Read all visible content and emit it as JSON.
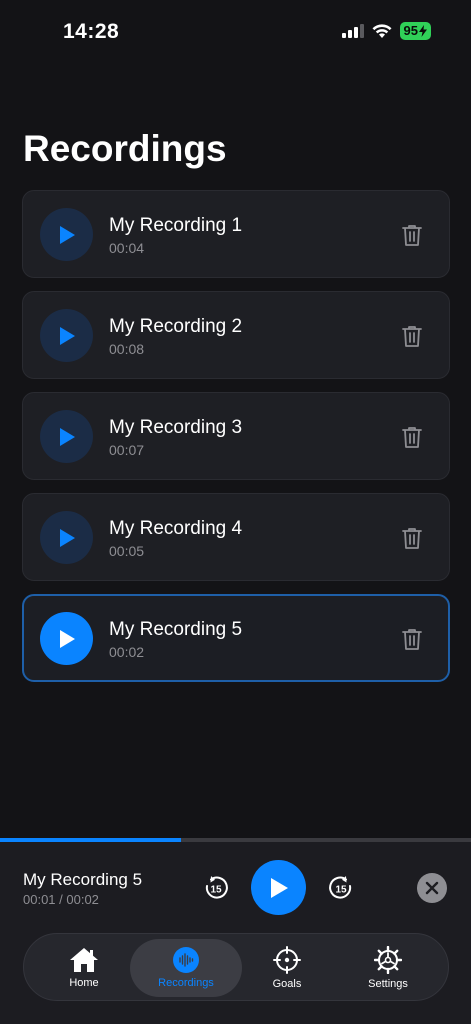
{
  "status": {
    "time": "14:28",
    "battery": "95"
  },
  "page": {
    "title": "Recordings"
  },
  "recordings": [
    {
      "name": "My Recording 1",
      "duration": "00:04"
    },
    {
      "name": "My Recording 2",
      "duration": "00:08"
    },
    {
      "name": "My Recording 3",
      "duration": "00:07"
    },
    {
      "name": "My Recording 4",
      "duration": "00:05"
    },
    {
      "name": "My Recording 5",
      "duration": "00:02"
    }
  ],
  "player": {
    "name": "My Recording 5",
    "time": "00:01 / 00:02",
    "progress_fraction": 0.5,
    "skip_back_label": "15",
    "skip_forward_label": "15"
  },
  "tabs": [
    {
      "label": "Home",
      "icon": "house-icon"
    },
    {
      "label": "Recordings",
      "icon": "waveform-icon"
    },
    {
      "label": "Goals",
      "icon": "scope-icon"
    },
    {
      "label": "Settings",
      "icon": "gear-icon"
    }
  ],
  "colors": {
    "accent": "#0a84ff",
    "background": "#131316",
    "battery": "#30d158"
  }
}
